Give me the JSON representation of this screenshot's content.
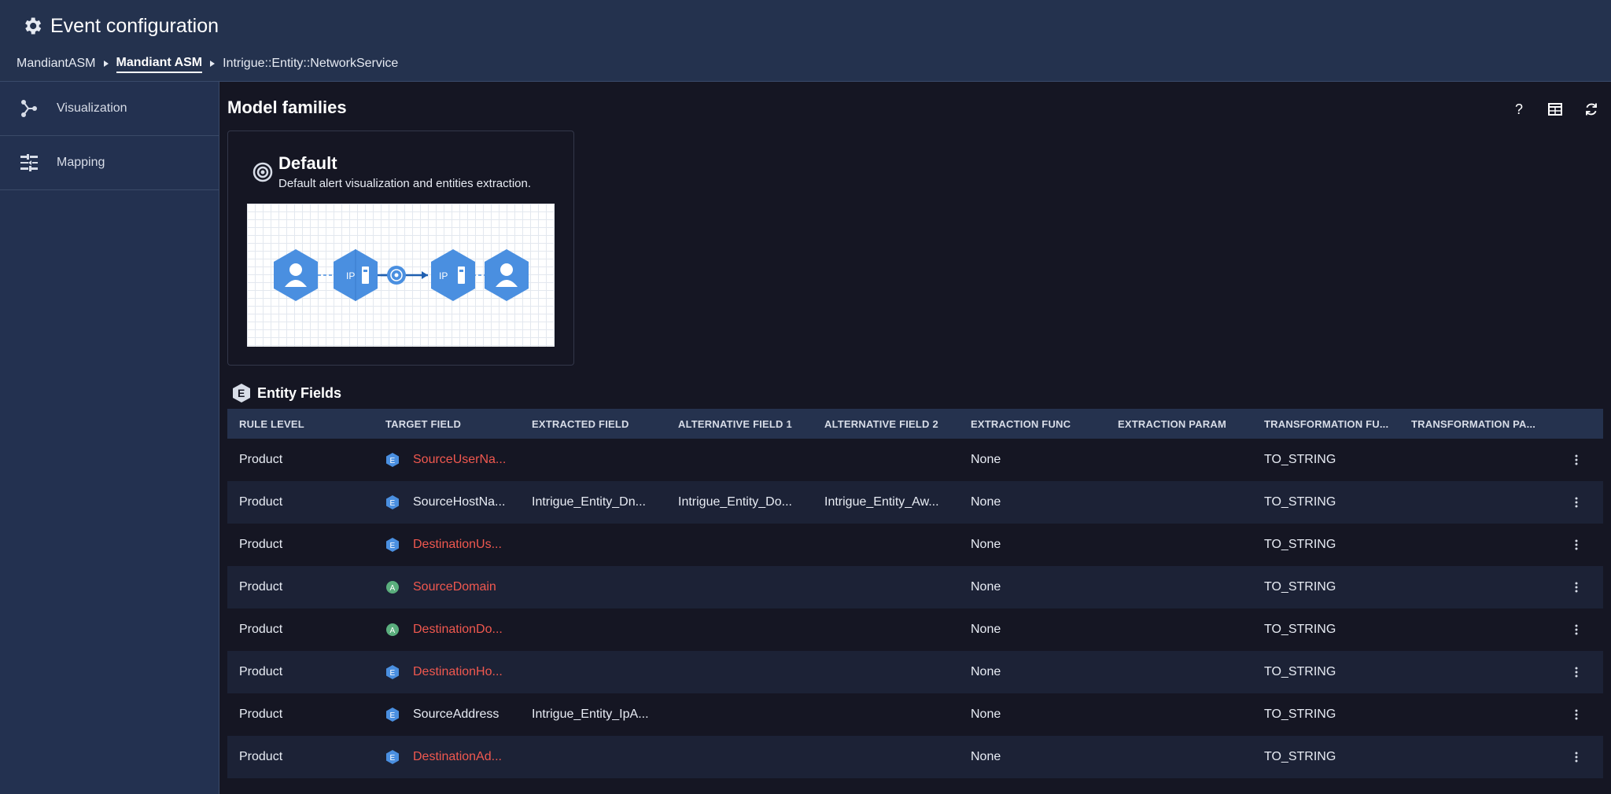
{
  "header": {
    "title": "Event configuration",
    "breadcrumb": [
      "MandiantASM",
      "Mandiant ASM",
      "Intrigue::Entity::NetworkService"
    ]
  },
  "sidebar": {
    "items": [
      {
        "label": "Visualization",
        "icon": "graph-nodes-icon"
      },
      {
        "label": "Mapping",
        "icon": "mapping-sliders-icon"
      }
    ]
  },
  "main": {
    "title": "Model families",
    "toolbar": {
      "help": "?",
      "icons": [
        "help-icon",
        "table-view-icon",
        "refresh-icon"
      ]
    },
    "card": {
      "title": "Default",
      "description": "Default alert visualization and entities extraction.",
      "preview_labels": [
        "IP",
        "IP"
      ]
    },
    "entity_fields": {
      "title": "Entity Fields",
      "badge": "E",
      "columns": [
        "RULE LEVEL",
        "TARGET FIELD",
        "EXTRACTED FIELD",
        "ALTERNATIVE FIELD 1",
        "ALTERNATIVE FIELD 2",
        "EXTRACTION FUNC",
        "EXTRACTION PARAM",
        "TRANSFORMATION FU...",
        "TRANSFORMATION PA..."
      ],
      "rows": [
        {
          "rule_level": "Product",
          "badge": "E",
          "target_field": "SourceUserNa...",
          "required": true,
          "extracted": "",
          "alt1": "",
          "alt2": "",
          "func": "None",
          "param": "",
          "transform": "TO_STRING",
          "tparam": ""
        },
        {
          "rule_level": "Product",
          "badge": "E",
          "target_field": "SourceHostNa...",
          "required": false,
          "extracted": "Intrigue_Entity_Dn...",
          "alt1": "Intrigue_Entity_Do...",
          "alt2": "Intrigue_Entity_Aw...",
          "func": "None",
          "param": "",
          "transform": "TO_STRING",
          "tparam": ""
        },
        {
          "rule_level": "Product",
          "badge": "E",
          "target_field": "DestinationUs...",
          "required": true,
          "extracted": "",
          "alt1": "",
          "alt2": "",
          "func": "None",
          "param": "",
          "transform": "TO_STRING",
          "tparam": ""
        },
        {
          "rule_level": "Product",
          "badge": "A",
          "target_field": "SourceDomain",
          "required": true,
          "extracted": "",
          "alt1": "",
          "alt2": "",
          "func": "None",
          "param": "",
          "transform": "TO_STRING",
          "tparam": ""
        },
        {
          "rule_level": "Product",
          "badge": "A",
          "target_field": "DestinationDo...",
          "required": true,
          "extracted": "",
          "alt1": "",
          "alt2": "",
          "func": "None",
          "param": "",
          "transform": "TO_STRING",
          "tparam": ""
        },
        {
          "rule_level": "Product",
          "badge": "E",
          "target_field": "DestinationHo...",
          "required": true,
          "extracted": "",
          "alt1": "",
          "alt2": "",
          "func": "None",
          "param": "",
          "transform": "TO_STRING",
          "tparam": ""
        },
        {
          "rule_level": "Product",
          "badge": "E",
          "target_field": "SourceAddress",
          "required": false,
          "extracted": "Intrigue_Entity_IpA...",
          "alt1": "",
          "alt2": "",
          "func": "None",
          "param": "",
          "transform": "TO_STRING",
          "tparam": ""
        },
        {
          "rule_level": "Product",
          "badge": "E",
          "target_field": "DestinationAd...",
          "required": true,
          "extracted": "",
          "alt1": "",
          "alt2": "",
          "func": "None",
          "param": "",
          "transform": "TO_STRING",
          "tparam": ""
        }
      ]
    }
  },
  "colors": {
    "accent_blue": "#4a8fe0",
    "badge_green": "#5aae7d",
    "required_red": "#f0584f",
    "header_bg": "#24324e"
  }
}
